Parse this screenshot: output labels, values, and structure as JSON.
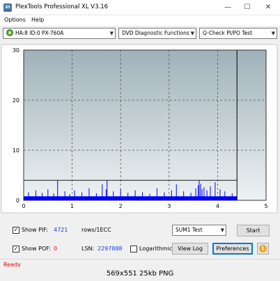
{
  "window": {
    "icon_text": "Xt",
    "title": "PlexTools Professional XL V3.16",
    "minimize": "—",
    "maximize": "☐",
    "close": "✕"
  },
  "menu": {
    "options": "Options",
    "help": "Help"
  },
  "toolbar": {
    "drive": "HA:8 ID:0  PX-760A",
    "function": "DVD Diagnostic Functions",
    "test": "Q-Check PI/PO Test"
  },
  "chart_data": {
    "type": "bar",
    "x_ticks": [
      "0",
      "1",
      "2",
      "3",
      "4",
      "5"
    ],
    "y_ticks": [
      "0",
      "10",
      "20",
      "30"
    ],
    "xlim": [
      0,
      5
    ],
    "ylim": [
      0,
      30
    ],
    "grid": true,
    "threshold_line": 4,
    "end_marker_x": 4.4,
    "series_color": "#0000ff",
    "spikes": [
      {
        "x": 0.1,
        "y": 1.6
      },
      {
        "x": 0.25,
        "y": 2
      },
      {
        "x": 0.38,
        "y": 1.5
      },
      {
        "x": 0.5,
        "y": 2.2
      },
      {
        "x": 0.62,
        "y": 1.4
      },
      {
        "x": 0.7,
        "y": 4
      },
      {
        "x": 0.85,
        "y": 1.8
      },
      {
        "x": 0.95,
        "y": 1.2
      },
      {
        "x": 1.05,
        "y": 2
      },
      {
        "x": 1.2,
        "y": 1.6
      },
      {
        "x": 1.35,
        "y": 2.4
      },
      {
        "x": 1.5,
        "y": 1.4
      },
      {
        "x": 1.62,
        "y": 3.2
      },
      {
        "x": 1.7,
        "y": 2.2
      },
      {
        "x": 1.72,
        "y": 4
      },
      {
        "x": 1.85,
        "y": 1.8
      },
      {
        "x": 2.0,
        "y": 2.2
      },
      {
        "x": 2.15,
        "y": 1.5
      },
      {
        "x": 2.3,
        "y": 2
      },
      {
        "x": 2.45,
        "y": 1.6
      },
      {
        "x": 2.6,
        "y": 1.3
      },
      {
        "x": 2.75,
        "y": 2.4
      },
      {
        "x": 2.9,
        "y": 1.6
      },
      {
        "x": 3.05,
        "y": 2
      },
      {
        "x": 3.15,
        "y": 3.2
      },
      {
        "x": 3.3,
        "y": 1.8
      },
      {
        "x": 3.45,
        "y": 1.5
      },
      {
        "x": 3.55,
        "y": 2.4
      },
      {
        "x": 3.6,
        "y": 3
      },
      {
        "x": 3.62,
        "y": 4
      },
      {
        "x": 3.65,
        "y": 3.3
      },
      {
        "x": 3.68,
        "y": 2.2
      },
      {
        "x": 3.72,
        "y": 2.6
      },
      {
        "x": 3.78,
        "y": 2
      },
      {
        "x": 3.85,
        "y": 2.8
      },
      {
        "x": 3.95,
        "y": 3.6
      },
      {
        "x": 4.05,
        "y": 2.2
      },
      {
        "x": 4.15,
        "y": 1.8
      },
      {
        "x": 4.3,
        "y": 1.4
      }
    ]
  },
  "controls": {
    "show_pif_label": "Show PIF:",
    "pif_value": "4721",
    "rows_label": "rows/1ECC",
    "show_pof_label": "Show POF:",
    "pof_value": "0",
    "lsn_label": "LSN:",
    "lsn_value": "2297888",
    "logarithmic_label": "Logarithmic",
    "sum_select": "SUM1 Test",
    "start_button": "Start",
    "view_log_button": "View Log",
    "preferences_button": "Preferences",
    "info_icon": "i",
    "check_mark": "✓"
  },
  "status": {
    "text": "Ready"
  },
  "caption": {
    "text": "569x551  25kb  PNG"
  }
}
